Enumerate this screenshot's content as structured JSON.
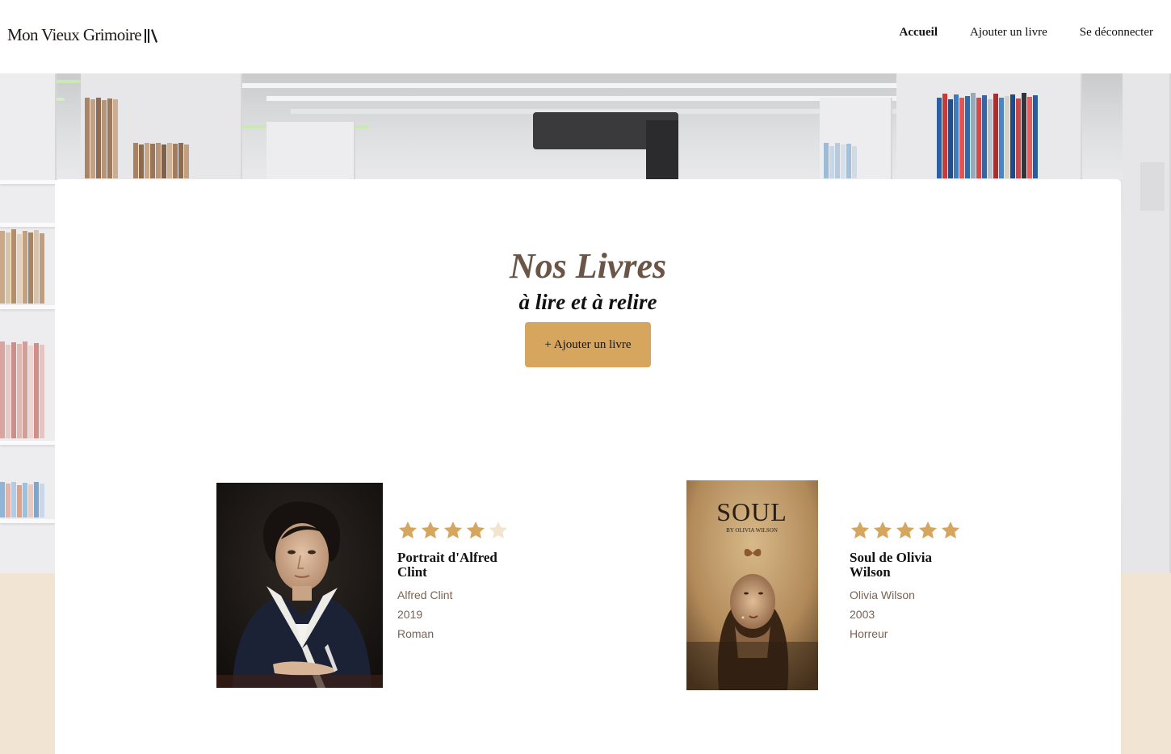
{
  "header": {
    "logo_text": "Mon Vieux Grimoire",
    "logo_icon": "books-icon",
    "nav": [
      {
        "label": "Accueil",
        "active": true
      },
      {
        "label": "Ajouter un livre",
        "active": false
      },
      {
        "label": "Se déconnecter",
        "active": false
      }
    ]
  },
  "main": {
    "title": "Nos Livres",
    "subtitle": "à lire et à relire",
    "add_button": "+ Ajouter un livre"
  },
  "books": [
    {
      "rating": 4,
      "title": "Portrait d'Alfred Clint",
      "author": "Alfred Clint",
      "year": "2019",
      "genre": "Roman"
    },
    {
      "rating": 5,
      "title": "Soul de Olivia Wilson",
      "author": "Olivia Wilson",
      "year": "2003",
      "genre": "Horreur",
      "cover_title": "SOUL",
      "cover_byline": "BY OLIVIA WILSON"
    }
  ],
  "colors": {
    "accent": "#d6a65f",
    "star_filled": "#d6a65f",
    "star_empty": "#f3e4cf",
    "title_brown": "#6b5547",
    "meta_brown": "#7a6352",
    "page_bg": "#f1e4d2"
  }
}
